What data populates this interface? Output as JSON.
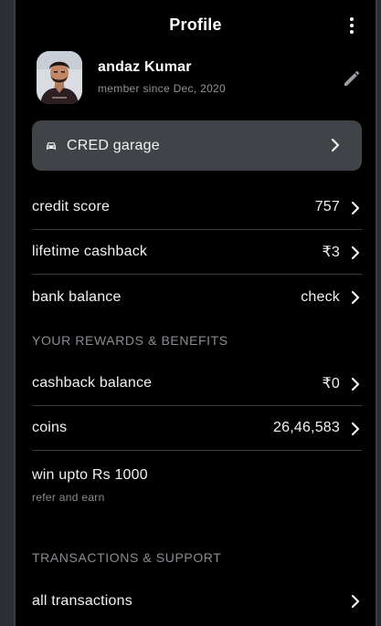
{
  "header": {
    "title": "Profile"
  },
  "profile": {
    "name": "andaz Kumar",
    "member_since": "member since Dec, 2020"
  },
  "garage": {
    "label": "CRED garage"
  },
  "account_rows": [
    {
      "label": "credit score",
      "value": "757"
    },
    {
      "label": "lifetime cashback",
      "value": "₹3"
    },
    {
      "label": "bank balance",
      "value": "check"
    }
  ],
  "rewards": {
    "heading": "YOUR REWARDS & BENEFITS",
    "rows": [
      {
        "label": "cashback balance",
        "value": "₹0"
      },
      {
        "label": "coins",
        "value": "26,46,583"
      }
    ],
    "refer": {
      "label": "win upto Rs 1000",
      "sub": "refer and earn"
    }
  },
  "support": {
    "heading": "TRANSACTIONS & SUPPORT",
    "rows": [
      {
        "label": "all transactions",
        "value": ""
      }
    ]
  },
  "colors": {
    "background": "#000000",
    "card": "#404347",
    "divider": "#3a3c40",
    "muted_text": "#8a8d92"
  }
}
